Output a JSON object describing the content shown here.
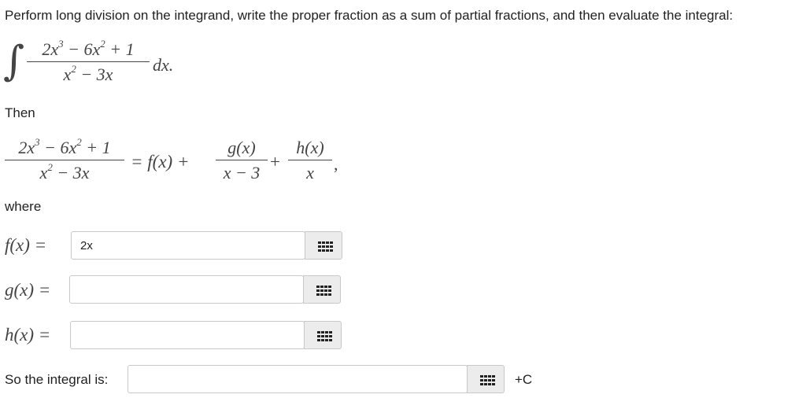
{
  "instruction": "Perform long division on the integrand, write the proper fraction as a sum of partial fractions, and then evaluate the integral:",
  "integral": {
    "numerator": "2x³ − 6x² + 1",
    "denominator": "x² − 3x",
    "differential": "dx."
  },
  "then_label": "Then",
  "decomposition": {
    "numerator": "2x³ − 6x² + 1",
    "denominator": "x² − 3x",
    "equals_f": "= f(x) +",
    "g_numerator": "g(x)",
    "g_denominator": "x − 3",
    "plus": "+",
    "h_numerator": "h(x)",
    "h_denominator": "x",
    "comma": ","
  },
  "where_label": "where",
  "fields": [
    {
      "label": "f(x) =",
      "value": "2x"
    },
    {
      "label": "g(x) =",
      "value": ""
    },
    {
      "label": "h(x) =",
      "value": ""
    }
  ],
  "integral_answer": {
    "label": "So the integral is:",
    "value": "",
    "suffix": "+C"
  },
  "palette_icon": "grid-dots-icon"
}
